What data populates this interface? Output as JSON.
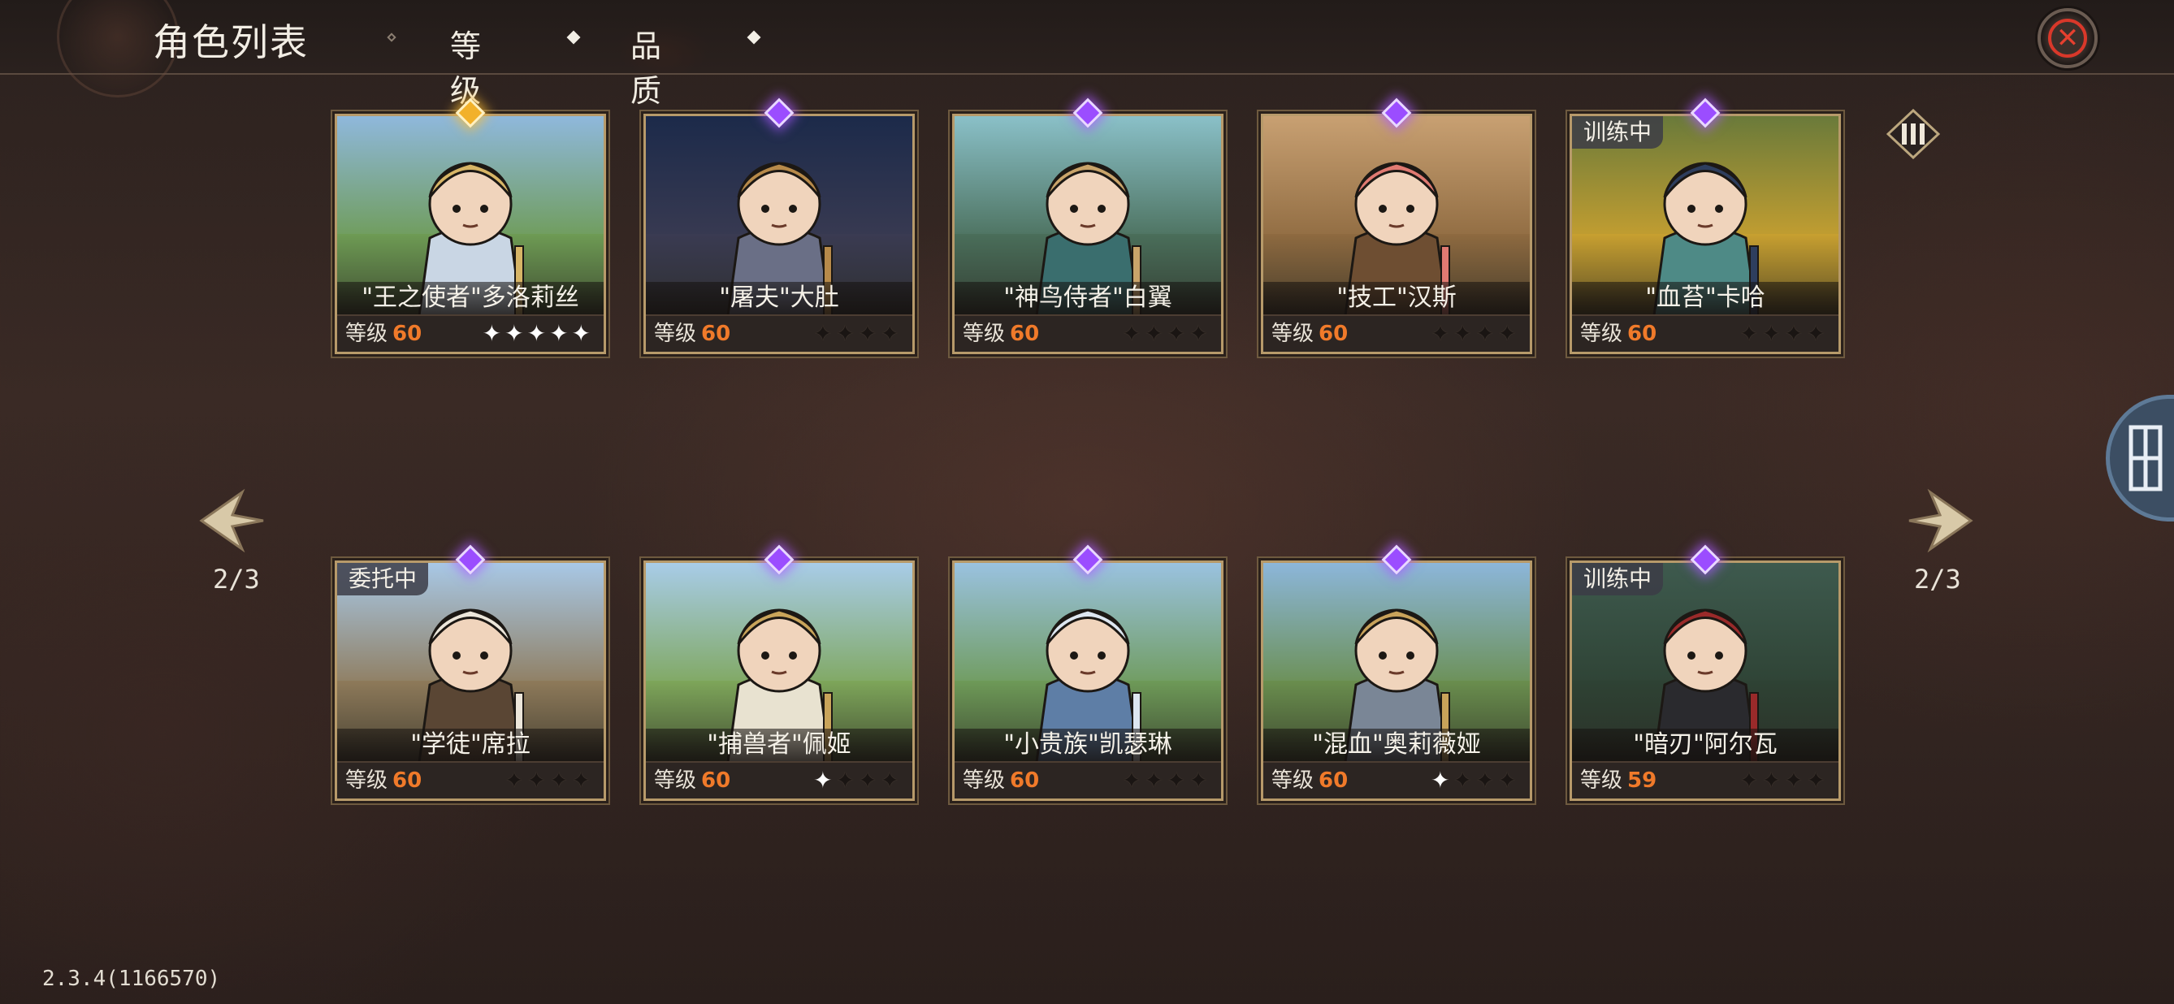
{
  "header": {
    "title": "角色列表",
    "tabs": [
      {
        "label": "等级",
        "active": false
      },
      {
        "label": "品质",
        "active": true
      }
    ]
  },
  "pagination": {
    "left_label": "2/3",
    "right_label": "2/3"
  },
  "version": "2.3.4(1166570)",
  "level_label": "等级",
  "characters": [
    {
      "name": "\"王之使者\"多洛莉丝",
      "level": "60",
      "stars": 5,
      "stars_lit": 5,
      "rarity": "gold",
      "status": "",
      "palette": {
        "sky": "#8fb8dc",
        "ground": "#6e9b54",
        "body": "#c9d6e4",
        "accent": "#d7b566"
      }
    },
    {
      "name": "\"屠夫\"大肚",
      "level": "60",
      "stars": 4,
      "stars_lit": 0,
      "rarity": "purple",
      "status": "",
      "palette": {
        "sky": "#1c2a4a",
        "ground": "#3a3b52",
        "body": "#6a6f86",
        "accent": "#b78a4a"
      }
    },
    {
      "name": "\"神鸟侍者\"白翼",
      "level": "60",
      "stars": 4,
      "stars_lit": 0,
      "rarity": "purple",
      "status": "",
      "palette": {
        "sky": "#8ac0c8",
        "ground": "#4a6e5a",
        "body": "#3a6e6e",
        "accent": "#c9a46a"
      }
    },
    {
      "name": "\"技工\"汉斯",
      "level": "60",
      "stars": 4,
      "stars_lit": 0,
      "rarity": "purple",
      "status": "",
      "palette": {
        "sky": "#c8a072",
        "ground": "#8e6a40",
        "body": "#6e4e32",
        "accent": "#e07a72"
      }
    },
    {
      "name": "\"血苔\"卡哈",
      "level": "60",
      "stars": 4,
      "stars_lit": 0,
      "rarity": "purple",
      "status": "训练中",
      "palette": {
        "sky": "#6a7a3a",
        "ground": "#c8a030",
        "body": "#4e8a86",
        "accent": "#2e3e5e"
      }
    },
    {
      "name": "\"学徒\"席拉",
      "level": "60",
      "stars": 4,
      "stars_lit": 0,
      "rarity": "purple",
      "status": "委托中",
      "palette": {
        "sky": "#a8c8e6",
        "ground": "#8e7a5a",
        "body": "#5a4634",
        "accent": "#ece6da"
      }
    },
    {
      "name": "\"捕兽者\"佩姬",
      "level": "60",
      "stars": 4,
      "stars_lit": 1,
      "rarity": "purple",
      "status": "",
      "palette": {
        "sky": "#a8cce8",
        "ground": "#7ea65a",
        "body": "#e8e2d0",
        "accent": "#c9a45a"
      }
    },
    {
      "name": "\"小贵族\"凯瑟琳",
      "level": "60",
      "stars": 4,
      "stars_lit": 0,
      "rarity": "purple",
      "status": "",
      "palette": {
        "sky": "#9ac2e0",
        "ground": "#6e9a58",
        "body": "#5e7ea6",
        "accent": "#dde6f0"
      }
    },
    {
      "name": "\"混血\"奥莉薇娅",
      "level": "60",
      "stars": 4,
      "stars_lit": 1,
      "rarity": "purple",
      "status": "",
      "palette": {
        "sky": "#8cb6da",
        "ground": "#6a8e4e",
        "body": "#7a8696",
        "accent": "#c8a25a"
      }
    },
    {
      "name": "\"暗刃\"阿尔瓦",
      "level": "59",
      "stars": 4,
      "stars_lit": 0,
      "rarity": "purple",
      "status": "训练中",
      "palette": {
        "sky": "#3e5a4e",
        "ground": "#2e4234",
        "body": "#2a2a2e",
        "accent": "#9a2a2a"
      }
    }
  ],
  "icons": {
    "close": "close-icon",
    "prev": "chevron-left-icon",
    "next": "chevron-right-icon",
    "filter": "filter-icon",
    "side": "side-panel-icon"
  }
}
